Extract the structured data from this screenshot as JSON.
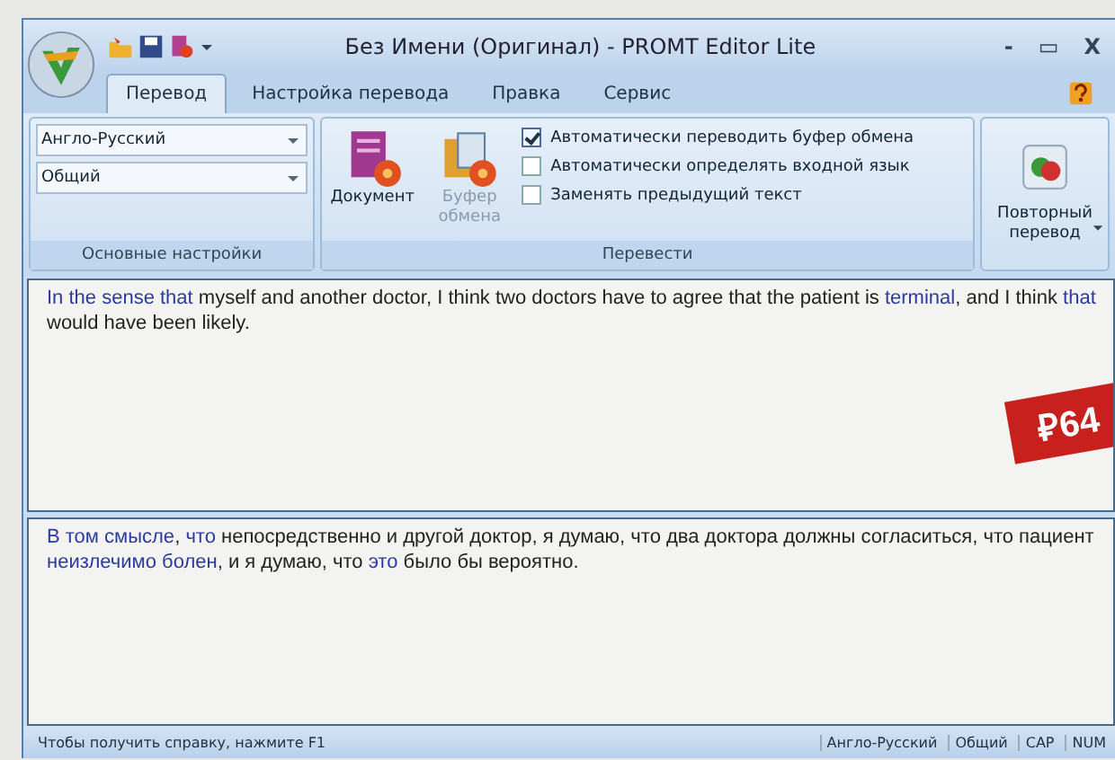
{
  "window": {
    "title": "Без Имени (Оригинал) - PROMT Editor Lite",
    "controls": [
      "-",
      "▭",
      "X"
    ]
  },
  "tabs": [
    {
      "label": "Перевод",
      "selected": true
    },
    {
      "label": "Настройка перевода",
      "selected": false
    },
    {
      "label": "Правка",
      "selected": false
    },
    {
      "label": "Сервис",
      "selected": false
    }
  ],
  "ribbon": {
    "settings": {
      "dropdowns": [
        "Англо-Русский",
        "Общий"
      ],
      "caption": "Основные настройки"
    },
    "translate": {
      "buttons": [
        {
          "label": "Документ",
          "disabled": false
        },
        {
          "label": "Буфер обмена",
          "disabled": true
        }
      ],
      "options": [
        {
          "label": "Автоматически переводить буфер обмена",
          "checked": true
        },
        {
          "label": "Автоматически определять входной язык",
          "checked": false
        },
        {
          "label": "Заменять предыдущий текст",
          "checked": false
        }
      ],
      "caption": "Перевести"
    },
    "retranslate": {
      "label": "Повторный перевод"
    }
  },
  "source_text": [
    {
      "text": "In the sense that",
      "highlighted": true
    },
    {
      "text": " myself and another doctor, I think two doctors have to agree that the patient is ",
      "highlighted": false
    },
    {
      "text": "terminal",
      "highlighted": true
    },
    {
      "text": ", and I think ",
      "highlighted": false
    },
    {
      "text": "that",
      "highlighted": true
    },
    {
      "text": " would have been likely.",
      "highlighted": false
    }
  ],
  "target_text": [
    {
      "text": "В том смысле",
      "highlighted": true
    },
    {
      "text": ", ",
      "highlighted": false
    },
    {
      "text": "что",
      "highlighted": true
    },
    {
      "text": " непосредственно и другой доктор, я думаю, что два доктора должны согласиться, что пациент ",
      "highlighted": false
    },
    {
      "text": "неизлечимо болен",
      "highlighted": true
    },
    {
      "text": ", и я думаю, что ",
      "highlighted": false
    },
    {
      "text": "это",
      "highlighted": true
    },
    {
      "text": " было бы вероятно.",
      "highlighted": false
    }
  ],
  "price_tag": "₽64",
  "status_bar": {
    "hint": "Чтобы получить справку, нажмите F1",
    "panels": [
      "Англо-Русский",
      "Общий",
      "CAP",
      "NUM"
    ]
  }
}
